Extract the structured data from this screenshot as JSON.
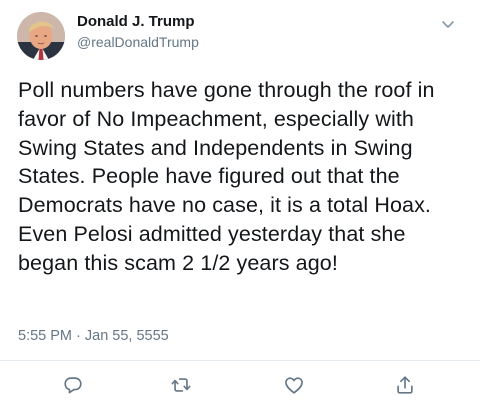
{
  "author": {
    "display_name": "Donald J. Trump",
    "handle": "@realDonaldTrump",
    "avatar_icon": "user-avatar-photo"
  },
  "tweet": {
    "text": "Poll numbers have gone through the roof in favor of No Impeachment, especially with Swing States and Independents in Swing States. People have figured out that the Democrats have no case, it is a total Hoax. Even Pelosi admitted yesterday that she began this scam 2 1/2 years ago!",
    "timestamp": "5:55 PM · Jan 55, 5555"
  },
  "actions": [
    {
      "name": "reply",
      "icon": "reply-icon"
    },
    {
      "name": "retweet",
      "icon": "retweet-icon"
    },
    {
      "name": "like",
      "icon": "heart-icon"
    },
    {
      "name": "share",
      "icon": "share-icon"
    }
  ],
  "menu": {
    "icon": "chevron-down-icon"
  },
  "colors": {
    "text_primary": "#14171a",
    "text_secondary": "#657786",
    "divider": "#e6ecf0",
    "background": "#ffffff"
  }
}
